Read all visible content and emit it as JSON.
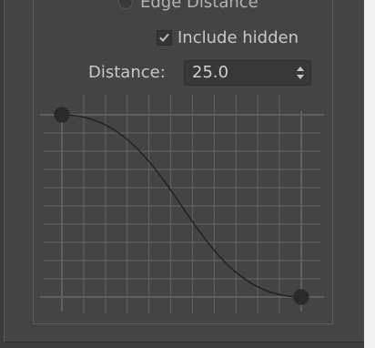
{
  "edge_distance": {
    "label": "Edge Distance",
    "selected": false
  },
  "include_hidden": {
    "label": "Include hidden",
    "checked": true
  },
  "distance": {
    "label": "Distance:",
    "value": "25.0"
  },
  "falloff_curve": {
    "start_point": [
      0,
      1
    ],
    "end_point": [
      1,
      0
    ],
    "grid": true
  },
  "colors": {
    "panel_background": "#444444",
    "grid_line": "#5f5f5f",
    "curve": "#1e1e1e",
    "control_point": "#2a2a2a"
  },
  "icons": {
    "radio": "radio-button-icon",
    "check": "checkmark-icon",
    "spinner": "up-down-arrows-icon"
  }
}
